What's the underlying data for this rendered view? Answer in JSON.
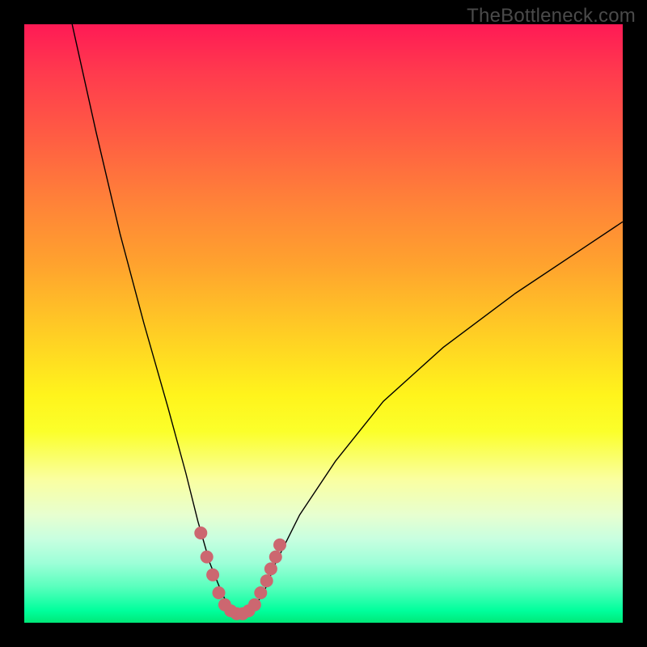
{
  "watermark": "TheBottleneck.com",
  "chart_data": {
    "type": "line",
    "title": "",
    "xlabel": "",
    "ylabel": "",
    "xlim": [
      0,
      100
    ],
    "ylim": [
      0,
      100
    ],
    "grid": false,
    "legend": false,
    "background_gradient": {
      "top": "#ff1a55",
      "middle": "#fff41c",
      "bottom": "#00ff9c"
    },
    "series": [
      {
        "name": "bottleneck-curve",
        "color": "#000000",
        "x": [
          8,
          12,
          16,
          20,
          24,
          27,
          29,
          31,
          33,
          34.5,
          36,
          37,
          38,
          40,
          42,
          46,
          52,
          60,
          70,
          82,
          94,
          100
        ],
        "y": [
          100,
          82,
          65,
          50,
          36,
          25,
          17,
          10,
          5,
          2,
          1,
          1,
          2,
          5,
          10,
          18,
          27,
          37,
          46,
          55,
          63,
          67
        ]
      }
    ],
    "markers": {
      "name": "highlight-dots",
      "color": "#cc6770",
      "radius_px": 8,
      "points": [
        {
          "x": 29.5,
          "y": 15
        },
        {
          "x": 30.5,
          "y": 11
        },
        {
          "x": 31.5,
          "y": 8
        },
        {
          "x": 32.5,
          "y": 5
        },
        {
          "x": 33.5,
          "y": 3
        },
        {
          "x": 34.5,
          "y": 2
        },
        {
          "x": 35.5,
          "y": 1.5
        },
        {
          "x": 36.5,
          "y": 1.5
        },
        {
          "x": 37.5,
          "y": 2
        },
        {
          "x": 38.5,
          "y": 3
        },
        {
          "x": 39.5,
          "y": 5
        },
        {
          "x": 40.5,
          "y": 7
        },
        {
          "x": 41.2,
          "y": 9
        },
        {
          "x": 42.0,
          "y": 11
        },
        {
          "x": 42.7,
          "y": 13
        }
      ]
    }
  }
}
